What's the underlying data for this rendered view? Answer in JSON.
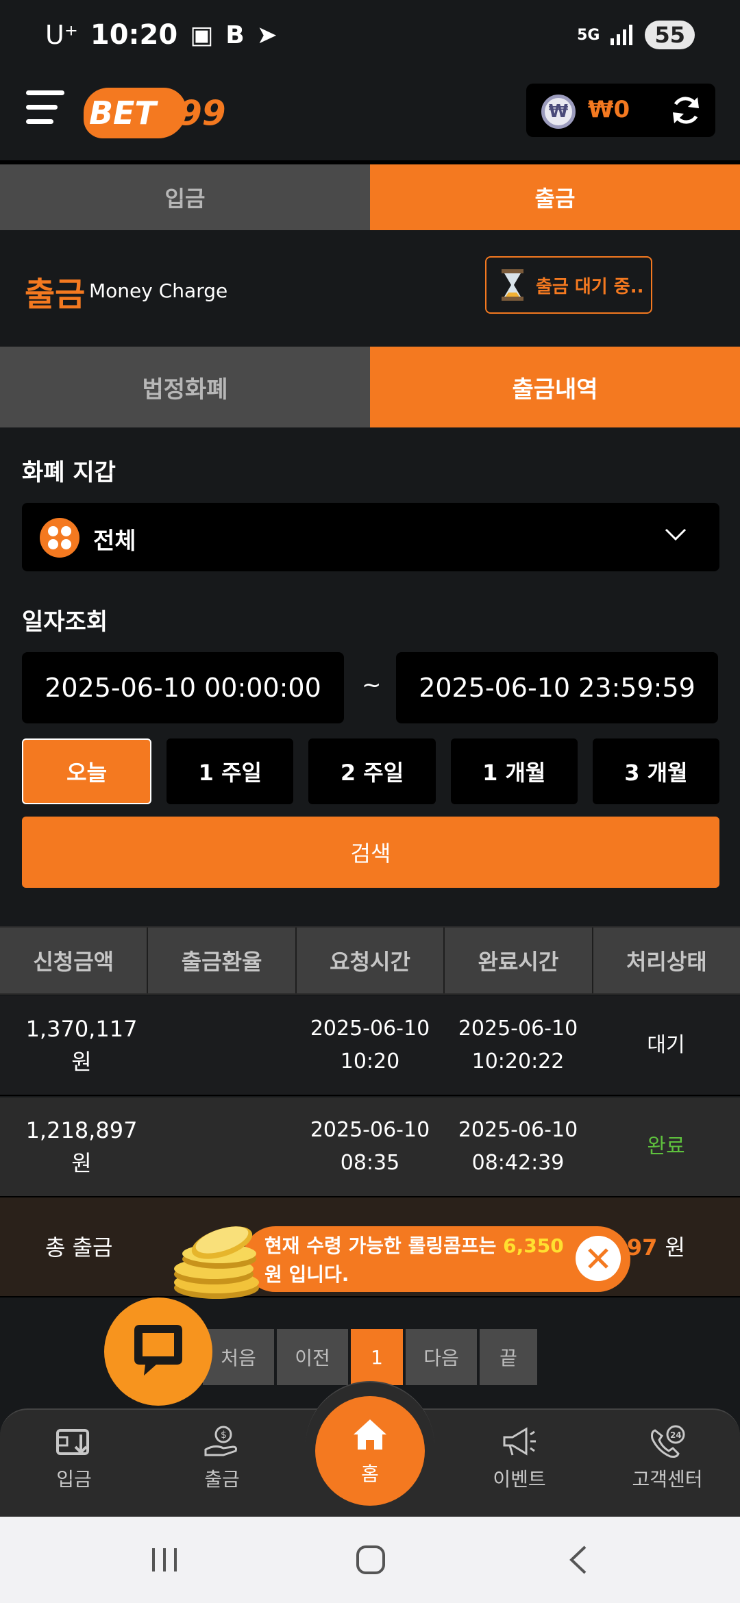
{
  "status_bar": {
    "carrier": "U⁺",
    "time": "10:20",
    "battery": "55",
    "network": "5G"
  },
  "header": {
    "logo_text": "BET",
    "logo_number": "99",
    "balance": "₩0",
    "currency_symbol": "₩"
  },
  "top_tabs": [
    {
      "label": "입금",
      "active": false
    },
    {
      "label": "출금",
      "active": true
    }
  ],
  "section": {
    "title": "출금",
    "subtitle": "Money Charge",
    "pending_label": "출금 대기 중.."
  },
  "sub_tabs": [
    {
      "label": "법정화폐",
      "active": false
    },
    {
      "label": "출금내역",
      "active": true
    }
  ],
  "wallet_filter": {
    "label": "화폐 지갑",
    "selected": "전체"
  },
  "date_filter": {
    "label": "일자조회",
    "start": "2025-06-10 00:00:00",
    "separator": "~",
    "end": "2025-06-10 23:59:59",
    "ranges": [
      "오늘",
      "1 주일",
      "2 주일",
      "1 개월",
      "3 개월"
    ],
    "active_range": "오늘",
    "search_label": "검색"
  },
  "table": {
    "headers": [
      "신청금액",
      "출금환율",
      "요청시간",
      "완료시간",
      "처리상태"
    ],
    "rows": [
      {
        "amount": "1,370,117 원",
        "rate": "",
        "request_date": "2025-06-10",
        "request_time": "10:20",
        "complete_date": "2025-06-10",
        "complete_time": "10:20:22",
        "status": "대기"
      },
      {
        "amount": "1,218,897 원",
        "rate": "",
        "request_date": "2025-06-10",
        "request_time": "08:35",
        "complete_date": "2025-06-10",
        "complete_time": "08:42:39",
        "status": "완료"
      }
    ],
    "total_label": "총 출금",
    "total_amount_visible": "897",
    "total_unit": "원"
  },
  "promo": {
    "text_before": "현재 수령 가능한 롤링콤프는 ",
    "highlight": "6,350",
    "text_after": " 원 입니다."
  },
  "pagination": [
    "처음",
    "이전",
    "1",
    "다음",
    "끝"
  ],
  "current_page": "1",
  "bottom_nav": {
    "deposit": "입금",
    "withdraw": "출금",
    "home": "홈",
    "event": "이벤트",
    "support": "고객센터",
    "support_badge": "24"
  },
  "colors": {
    "accent": "#f47920",
    "background": "#17191b",
    "done": "#5ec13d",
    "highlight": "#ffe030"
  }
}
